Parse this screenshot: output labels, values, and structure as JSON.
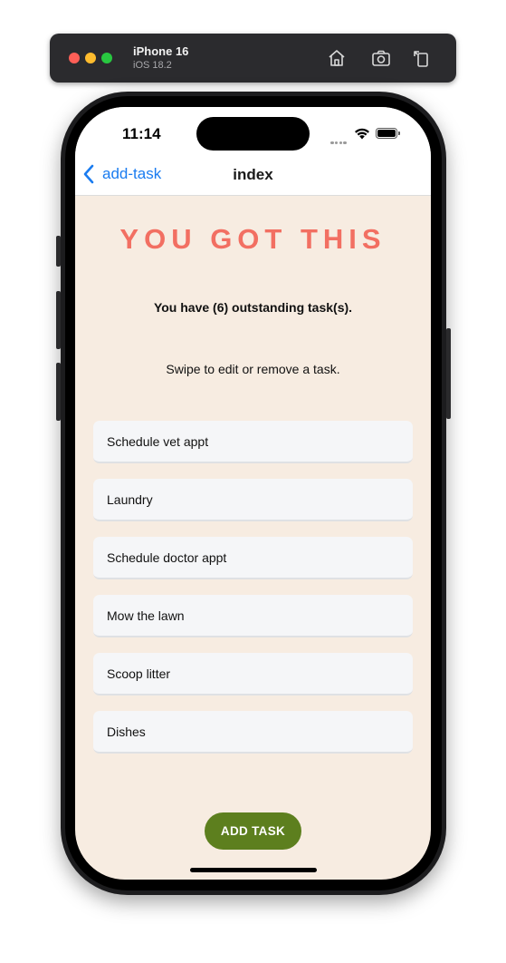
{
  "simulator": {
    "device_name": "iPhone 16",
    "os_version": "iOS 18.2",
    "icons": [
      "home-icon",
      "screenshot-icon",
      "rotate-icon"
    ]
  },
  "status_bar": {
    "time": "11:14"
  },
  "nav": {
    "back_label": "add-task",
    "title": "index"
  },
  "main": {
    "headline": "YOU GOT THIS",
    "task_count_text": "You have (6) outstanding task(s).",
    "hint": "Swipe to edit or remove a task.",
    "tasks": [
      "Schedule vet appt",
      "Laundry",
      "Schedule doctor appt",
      "Mow the lawn",
      "Scoop litter",
      "Dishes"
    ],
    "add_button_label": "ADD TASK"
  },
  "colors": {
    "background": "#f7ece1",
    "headline": "#f26f62",
    "link": "#1a7cf0",
    "add_button": "#5d7f1e",
    "task_item": "#f5f6f8"
  }
}
